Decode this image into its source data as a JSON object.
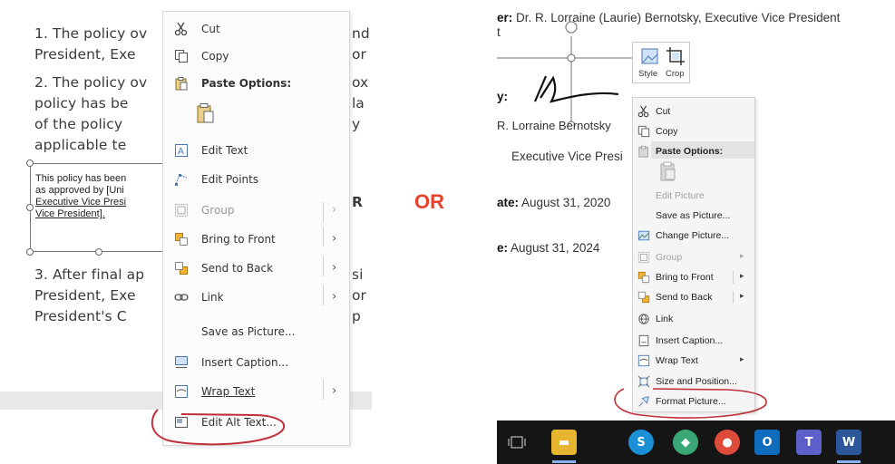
{
  "left": {
    "doc_lines": [
      "1.  The policy ov",
      "     President, Exe",
      "2.  The policy ov",
      "     policy has be",
      "     of the policy",
      "     applicable te",
      "3.  After final ap",
      "     President, Exe",
      "     President's C"
    ],
    "right_fragments": [
      "nd",
      "or",
      "ox",
      "la",
      "y",
      "R",
      "si",
      "or",
      "p"
    ],
    "textbox_lines": [
      "This policy has been",
      "as approved by [Uni",
      "Executive Vice Presi",
      "Vice President]."
    ],
    "menu": {
      "cut": "Cut",
      "copy": "Copy",
      "paste_options": "Paste Options:",
      "edit_text": "Edit Text",
      "edit_points": "Edit Points",
      "group": "Group",
      "bring_to_front": "Bring to Front",
      "send_to_back": "Send to Back",
      "link": "Link",
      "save_as_picture": "Save as Picture...",
      "insert_caption": "Insert Caption...",
      "wrap_text": "Wrap Text",
      "edit_alt_text": "Edit Alt Text..."
    }
  },
  "or_text": "OR",
  "right": {
    "doc": {
      "owner_label": "er:",
      "owner_value": " Dr. R. Lorraine (Laurie) Bernotsky, Executive Vice President",
      "owner_wrap": "t",
      "approved_label": "y:",
      "signer_name": "R. Lorraine Bernotsky",
      "signer_title": "Executive Vice Presi",
      "date1_label": "ate:",
      "date1_value": " August 31, 2020",
      "date2_label": "e:",
      "date2_value": " August 31, 2024"
    },
    "mini_toolbar": {
      "style": "Style",
      "crop": "Crop"
    },
    "menu": {
      "cut": "Cut",
      "copy": "Copy",
      "paste_options": "Paste Options:",
      "edit_picture": "Edit Picture",
      "save_as_picture": "Save as Picture...",
      "change_picture": "Change Picture...",
      "group": "Group",
      "bring_to_front": "Bring to Front",
      "send_to_back": "Send to Back",
      "link": "Link",
      "insert_caption": "Insert Caption...",
      "wrap_text": "Wrap Text",
      "size_and_position": "Size and Position...",
      "format_picture": "Format Picture..."
    },
    "taskbar_icons": [
      "task-view",
      "file-explorer",
      "skype",
      "maps",
      "chrome",
      "outlook",
      "teams",
      "word"
    ]
  },
  "colors": {
    "or_red": "#e8432a",
    "annotation_red": "#c0303a",
    "taskbar": "#151515"
  }
}
